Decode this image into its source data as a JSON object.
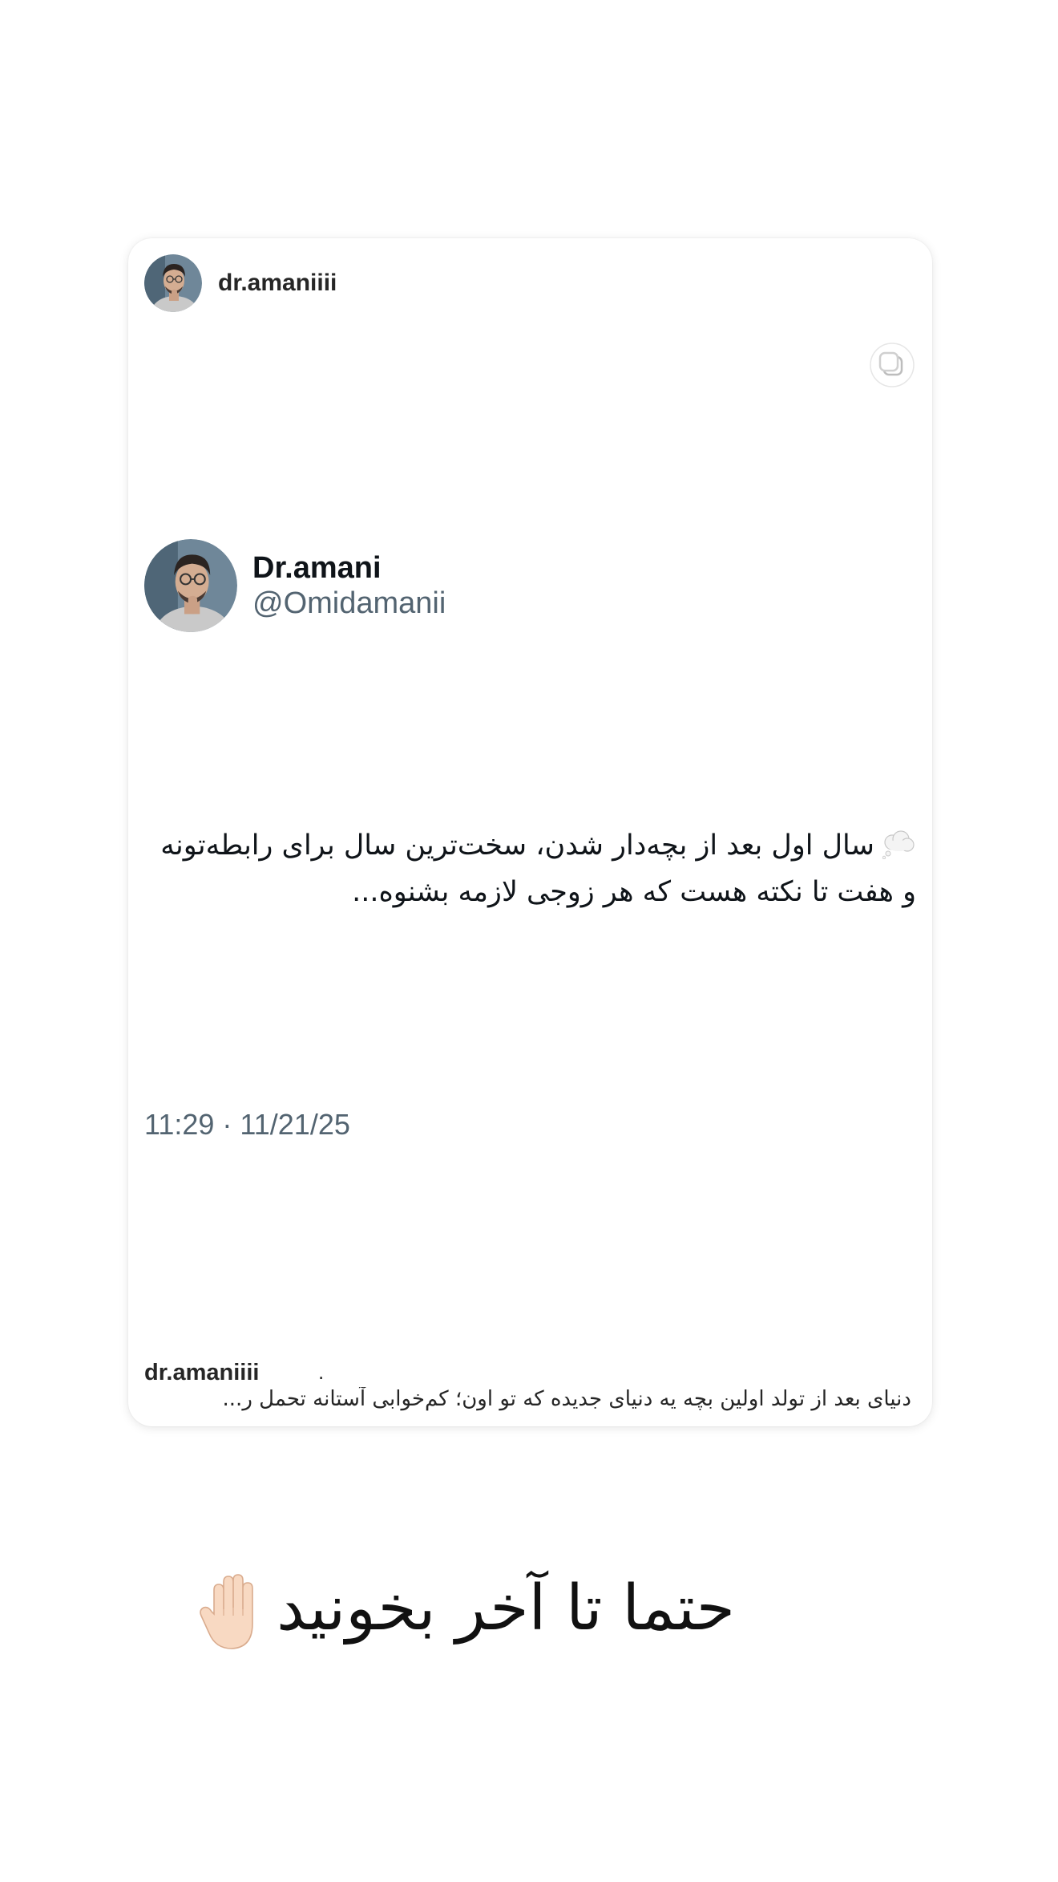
{
  "post": {
    "username": "dr.amaniiii",
    "multi_image_icon": "carousel-icon"
  },
  "tweet": {
    "display_name": "Dr.amani",
    "handle": "@Omidamanii",
    "emoji": "thought-balloon-icon",
    "text": "سال اول بعد از بچه‌دار شدن، سخت‌ترین سال برای رابطه‌تونه و هفت تا نکته هست که هر زوجی لازمه بشنوه...",
    "timestamp": "11:29 · 11/21/25"
  },
  "footer": {
    "username": "dr.amaniiii",
    "separator": ".",
    "caption": "دنیای بعد از تولد اولین بچه یه دنیای جدیده که تو اون؛ کم‌خوابی آستانه تحمل ر..."
  },
  "overlay": {
    "text": "حتما تا آخر بخونید",
    "icon": "raised-hand-icon"
  }
}
